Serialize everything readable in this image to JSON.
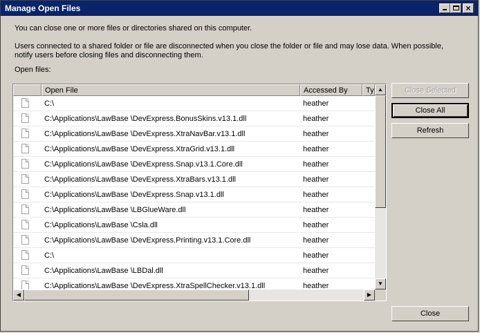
{
  "window": {
    "title": "Manage Open Files"
  },
  "intro_text": "You can close one or more files or directories shared on this computer.",
  "warning_text": "Users connected to a shared folder or file are disconnected when you close the folder or file and may lose data. When possible, notify users before closing files and disconnecting them.",
  "open_files_label": "Open files:",
  "columns": {
    "open_file": "Open File",
    "accessed_by": "Accessed By",
    "type": "Typ"
  },
  "rows": [
    {
      "open_file": "C:\\",
      "accessed_by": "heather"
    },
    {
      "open_file": "C:\\Applications\\LawBase \\DevExpress.BonusSkins.v13.1.dll",
      "accessed_by": "heather"
    },
    {
      "open_file": "C:\\Applications\\LawBase \\DevExpress.XtraNavBar.v13.1.dll",
      "accessed_by": "heather"
    },
    {
      "open_file": "C:\\Applications\\LawBase \\DevExpress.XtraGrid.v13.1.dll",
      "accessed_by": "heather"
    },
    {
      "open_file": "C:\\Applications\\LawBase \\DevExpress.Snap.v13.1.Core.dll",
      "accessed_by": "heather"
    },
    {
      "open_file": "C:\\Applications\\LawBase \\DevExpress.XtraBars.v13.1.dll",
      "accessed_by": "heather"
    },
    {
      "open_file": "C:\\Applications\\LawBase \\DevExpress.Snap.v13.1.dll",
      "accessed_by": "heather"
    },
    {
      "open_file": "C:\\Applications\\LawBase \\LBGlueWare.dll",
      "accessed_by": "heather"
    },
    {
      "open_file": "C:\\Applications\\LawBase \\Csla.dll",
      "accessed_by": "heather"
    },
    {
      "open_file": "C:\\Applications\\LawBase \\DevExpress.Printing.v13.1.Core.dll",
      "accessed_by": "heather"
    },
    {
      "open_file": "C:\\",
      "accessed_by": "heather"
    },
    {
      "open_file": "C:\\Applications\\LawBase \\LBDal.dll",
      "accessed_by": "heather"
    },
    {
      "open_file": "C:\\Applications\\LawBase \\DevExpress.XtraSpellChecker.v13.1.dll",
      "accessed_by": "heather"
    }
  ],
  "buttons": {
    "close_selected": "Close Selected",
    "close_all": "Close All",
    "refresh": "Refresh",
    "close": "Close"
  },
  "icons": {
    "minimize": "minimize-icon",
    "maximize": "maximize-icon",
    "close": "close-icon",
    "file": "file-icon"
  },
  "colors": {
    "titlebar": "#0a246a",
    "face": "#d4d0c8"
  }
}
